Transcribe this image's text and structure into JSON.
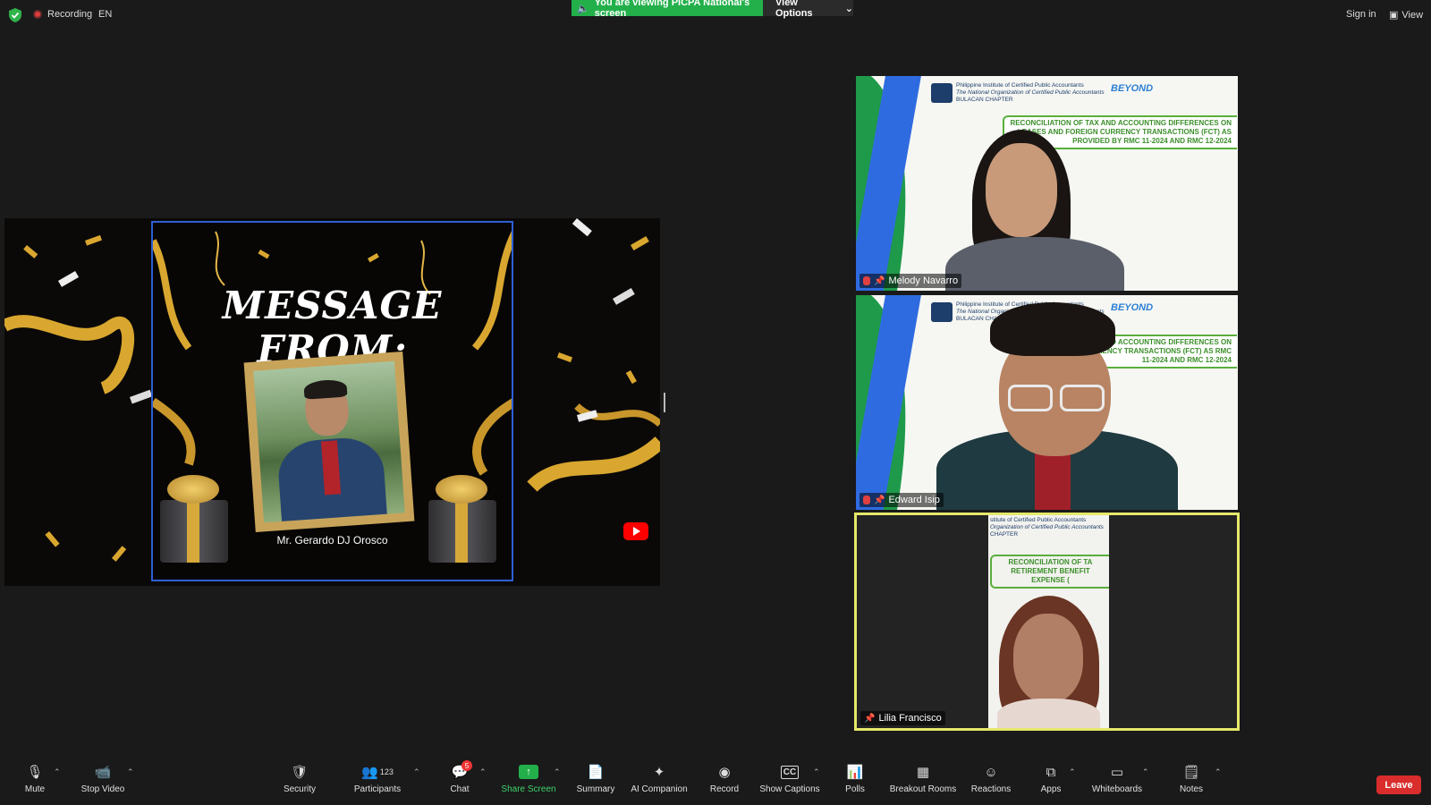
{
  "topbar": {
    "recording_label": "Recording",
    "language": "EN",
    "viewing_banner": "You are viewing PICPA National's screen",
    "view_options": "View Options",
    "sign_in": "Sign in",
    "view": "View"
  },
  "shared_screen": {
    "title": "MESSAGE FROM:",
    "caption": "Mr. Gerardo DJ Orosco"
  },
  "slide": {
    "org_line1": "Philippine Institute of Certified Public Accountants",
    "org_line2": "The National Organization of Certified Public Accountants",
    "org_line3": "BULACAN CHAPTER",
    "brand": "BEYOND",
    "topic_full": "RECONCILIATION OF TAX AND ACCOUNTING DIFFERENCES ON LEASES AND FOREIGN CURRENCY TRANSACTIONS (FCT) AS PROVIDED BY RMC 11-2024 AND RMC 12-2024",
    "topic_cut": "AND ACCOUNTING DIFFERENCES ON RENCY TRANSACTIONS (FCT) AS RMC 11-2024 AND RMC 12-2024",
    "topic3": "RECONCILIATION OF TA RETIREMENT BENEFIT EXPENSE (",
    "org3_line1": "stitute of Certified Public Accountants",
    "org3_line2": "Organization of Certified Public Accountants",
    "org3_line3": "CHAPTER"
  },
  "participants": [
    {
      "name": "Melody Navarro"
    },
    {
      "name": "Edward Isip"
    },
    {
      "name": "Lilia Francisco"
    }
  ],
  "toolbar": {
    "mute": "Mute",
    "stop_video": "Stop Video",
    "security": "Security",
    "participants": "Participants",
    "participant_count": "123",
    "chat": "Chat",
    "chat_badge": "5",
    "share_screen": "Share Screen",
    "summary": "Summary",
    "ai_companion": "AI Companion",
    "record": "Record",
    "show_captions": "Show Captions",
    "polls": "Polls",
    "breakout_rooms": "Breakout Rooms",
    "reactions": "Reactions",
    "apps": "Apps",
    "whiteboards": "Whiteboards",
    "notes": "Notes",
    "leave": "Leave"
  },
  "colors": {
    "accent_green": "#23b04b",
    "leave_red": "#d92c2c",
    "active_speaker_border": "#e5e86a",
    "share_frame_border": "#2f5fd6"
  }
}
